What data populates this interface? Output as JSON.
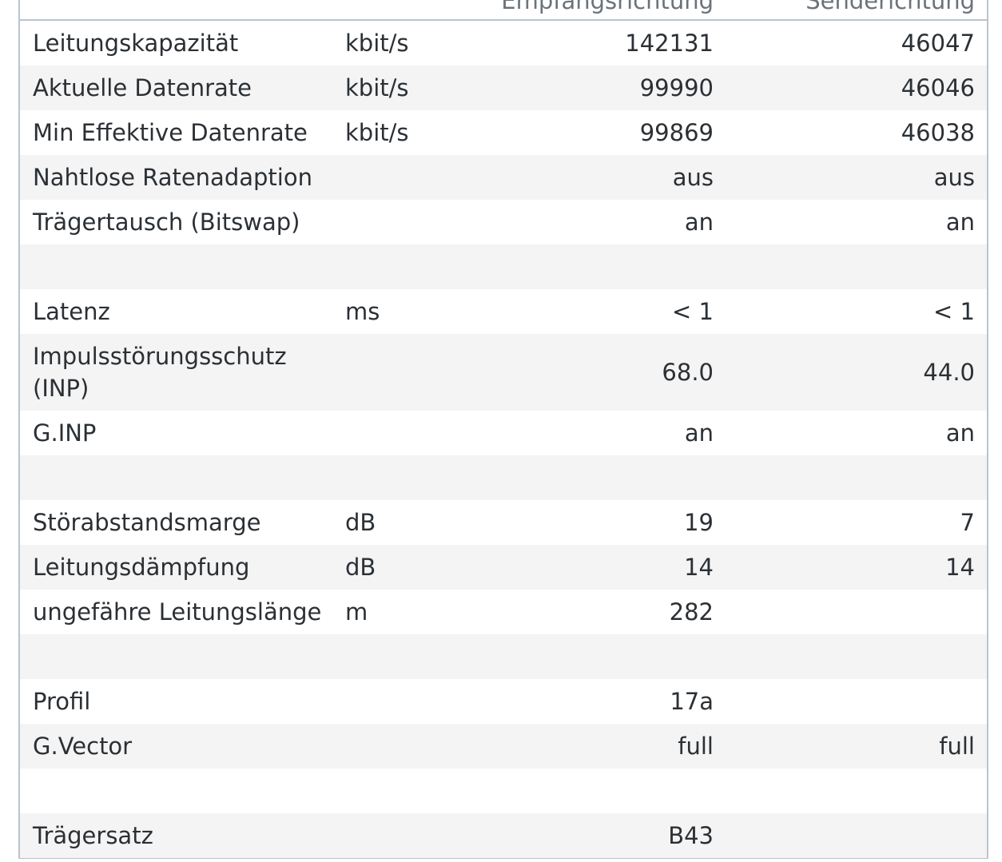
{
  "header": {
    "downstream": "Empfangsrichtung",
    "upstream": "Senderichtung"
  },
  "rows": [
    {
      "label": "Leitungskapazität",
      "unit": "kbit/s",
      "down": "142131",
      "up": "46047"
    },
    {
      "label": "Aktuelle Datenrate",
      "unit": "kbit/s",
      "down": "99990",
      "up": "46046"
    },
    {
      "label": "Min Effektive Datenrate",
      "unit": "kbit/s",
      "down": "99869",
      "up": "46038"
    },
    {
      "label": "Nahtlose Ratenadaption",
      "unit": "",
      "down": "aus",
      "up": "aus"
    },
    {
      "label": "Trägertausch (Bitswap)",
      "unit": "",
      "down": "an",
      "up": "an"
    },
    {
      "label": "",
      "unit": "",
      "down": "",
      "up": ""
    },
    {
      "label": "Latenz",
      "unit": "ms",
      "down": "< 1",
      "up": "< 1"
    },
    {
      "label": "Impulsstörungsschutz (INP)",
      "unit": "",
      "down": "68.0",
      "up": "44.0"
    },
    {
      "label": "G.INP",
      "unit": "",
      "down": "an",
      "up": "an"
    },
    {
      "label": "",
      "unit": "",
      "down": "",
      "up": ""
    },
    {
      "label": "Störabstandsmarge",
      "unit": "dB",
      "down": "19",
      "up": "7"
    },
    {
      "label": "Leitungsdämpfung",
      "unit": "dB",
      "down": "14",
      "up": "14"
    },
    {
      "label": "ungefähre Leitungslänge",
      "unit": "m",
      "down": "282",
      "up": ""
    },
    {
      "label": "",
      "unit": "",
      "down": "",
      "up": ""
    },
    {
      "label": "Profil",
      "unit": "",
      "down": "17a",
      "up": ""
    },
    {
      "label": "G.Vector",
      "unit": "",
      "down": "full",
      "up": "full"
    },
    {
      "label": "",
      "unit": "",
      "down": "",
      "up": ""
    },
    {
      "label": "Trägersatz",
      "unit": "",
      "down": "B43",
      "up": ""
    }
  ]
}
